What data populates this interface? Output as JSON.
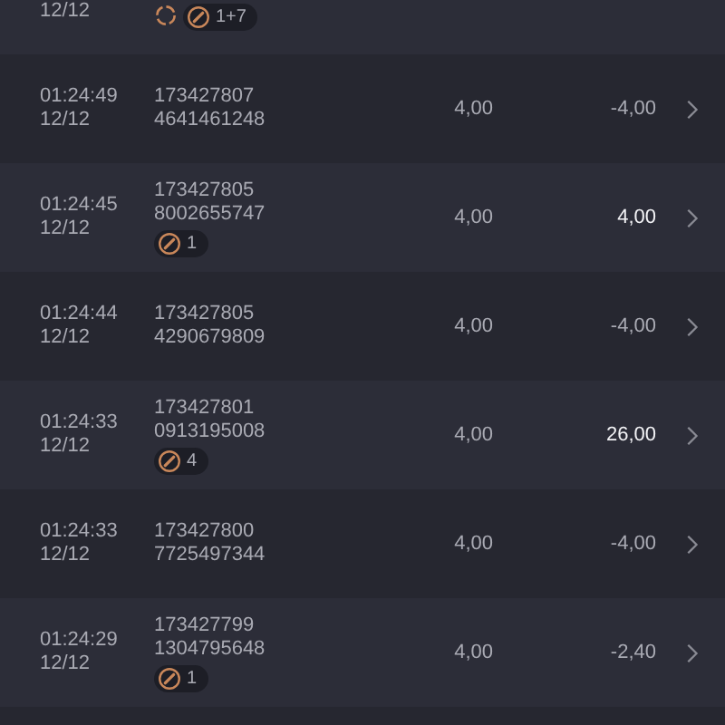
{
  "rows": [
    {
      "date": "12/12",
      "ids": [],
      "pending": true,
      "badge": "1+7"
    },
    {
      "time": "01:24:49",
      "date": "12/12",
      "ids": [
        "173427807",
        "4641461248"
      ],
      "pending": false,
      "stake": "4,00",
      "payout": "-4,00",
      "highlighted": false
    },
    {
      "time": "01:24:45",
      "date": "12/12",
      "ids": [
        "173427805",
        "8002655747"
      ],
      "pending": false,
      "badge": "1",
      "stake": "4,00",
      "payout": "4,00",
      "highlighted": true
    },
    {
      "time": "01:24:44",
      "date": "12/12",
      "ids": [
        "173427805",
        "4290679809"
      ],
      "pending": false,
      "stake": "4,00",
      "payout": "-4,00",
      "highlighted": false
    },
    {
      "time": "01:24:33",
      "date": "12/12",
      "ids": [
        "173427801",
        "0913195008"
      ],
      "pending": false,
      "badge": "4",
      "stake": "4,00",
      "payout": "26,00",
      "highlighted": true
    },
    {
      "time": "01:24:33",
      "date": "12/12",
      "ids": [
        "173427800",
        "7725497344"
      ],
      "pending": false,
      "stake": "4,00",
      "payout": "-4,00",
      "highlighted": false
    },
    {
      "time": "01:24:29",
      "date": "12/12",
      "ids": [
        "173427799",
        "1304795648"
      ],
      "pending": false,
      "badge": "1",
      "stake": "4,00",
      "payout": "-2,40",
      "highlighted": false
    }
  ]
}
